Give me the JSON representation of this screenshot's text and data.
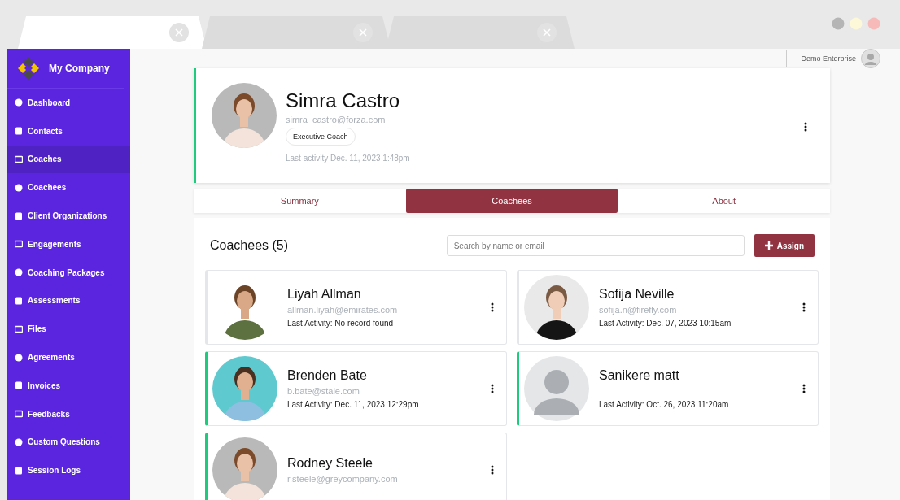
{
  "browser_tabs": [
    {
      "selected": true
    },
    {
      "selected": false
    },
    {
      "selected": false
    }
  ],
  "sidebar": {
    "company": "My Company",
    "items": [
      {
        "label": "Dashboard",
        "selected": false
      },
      {
        "label": "Contacts",
        "selected": false
      },
      {
        "label": "Coaches",
        "selected": true
      },
      {
        "label": "Coachees",
        "selected": false
      },
      {
        "label": "Client Organizations",
        "selected": false
      },
      {
        "label": "Engagements",
        "selected": false
      },
      {
        "label": "Coaching Packages",
        "selected": false
      },
      {
        "label": "Assessments",
        "selected": false
      },
      {
        "label": "Files",
        "selected": false
      },
      {
        "label": "Agreements",
        "selected": false
      },
      {
        "label": "Invoices",
        "selected": false
      },
      {
        "label": "Feedbacks",
        "selected": false
      },
      {
        "label": "Custom Questions",
        "selected": false
      },
      {
        "label": "Session Logs",
        "selected": false
      }
    ]
  },
  "topbar": {
    "account": "Demo Enterprise"
  },
  "coach": {
    "name": "Simra Castro",
    "email": "simra_castro@forza.com",
    "role": "Executive Coach",
    "last_activity": "Last activity Dec. 11, 2023 1:48pm",
    "accent": true
  },
  "tabs": [
    {
      "label": "Summary",
      "selected": false
    },
    {
      "label": "Coachees",
      "selected": true
    },
    {
      "label": "About",
      "selected": false
    }
  ],
  "coachees_panel": {
    "title": "Coachees (5)",
    "search": {
      "placeholder": "Search by name or email"
    },
    "assign_button": "Assign",
    "cards": [
      {
        "name": "Liyah Allman",
        "email": "allman.liyah@emirates.com",
        "last_activity": "Last Activity: No record found",
        "accent": false,
        "kind": "picture"
      },
      {
        "name": "Sofija Neville",
        "email": "sofija.n@firefly.com",
        "last_activity": "Last Activity: Dec. 07, 2023 10:15am",
        "accent": false,
        "kind": "picture"
      },
      {
        "name": "Brenden Bate",
        "email": "b.bate@stale.com",
        "last_activity": "Last Activity: Dec. 11, 2023 12:29pm",
        "accent": true,
        "kind": "picture"
      },
      {
        "name": "Sanikere matt",
        "last_activity": "Last Activity: Oct. 26, 2023 11:20am",
        "accent": true,
        "kind": "placeholder"
      },
      {
        "name": "Rodney Steele",
        "email": "r.steele@greycompany.com",
        "accent": true,
        "kind": "picture"
      }
    ]
  }
}
